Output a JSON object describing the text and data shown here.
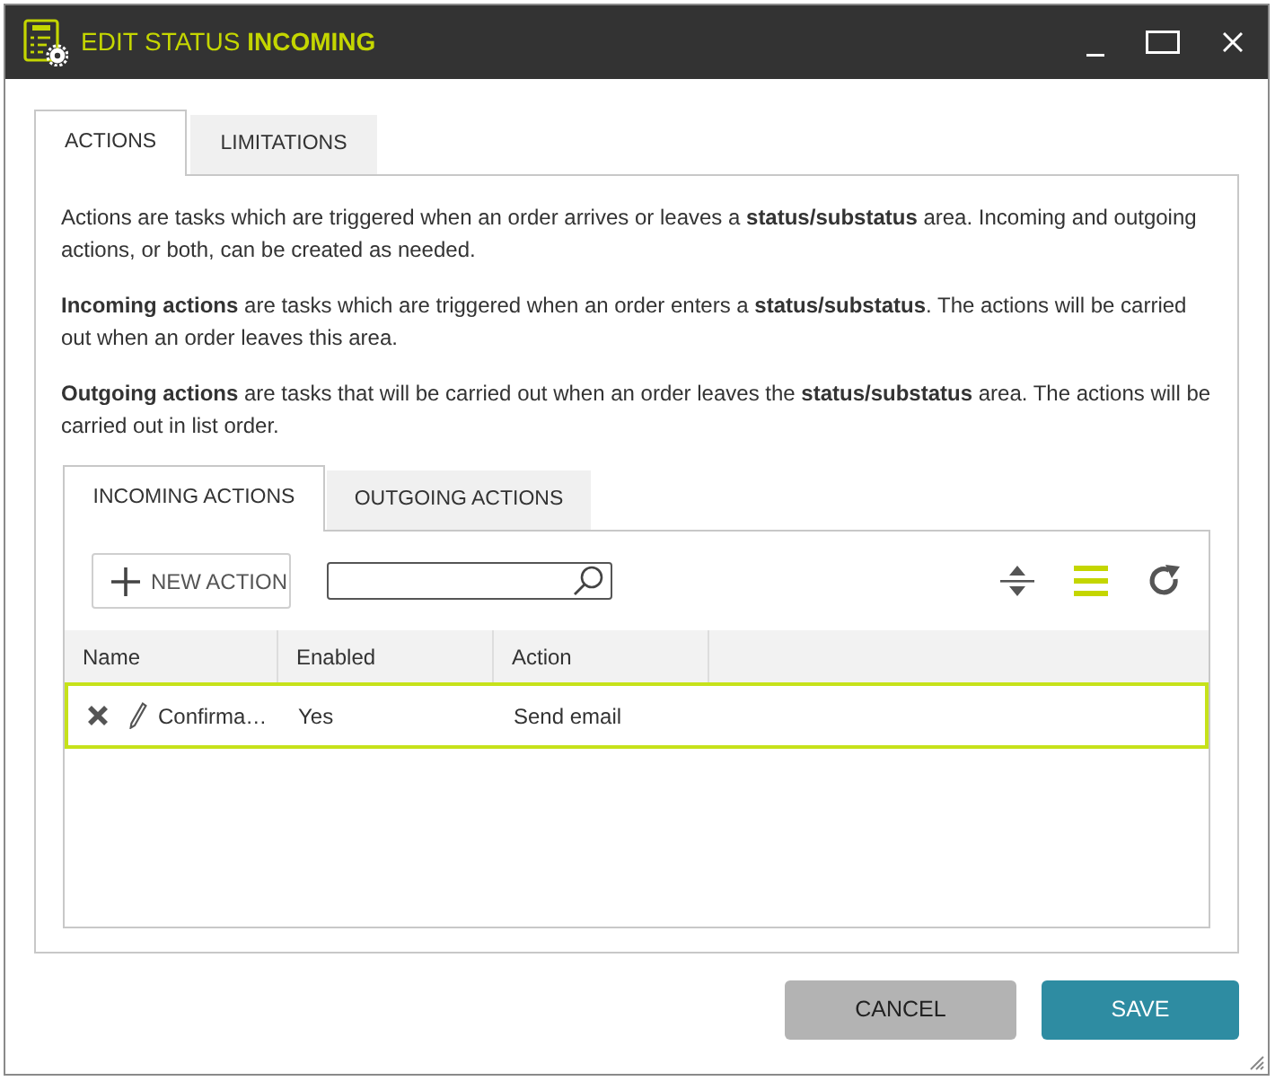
{
  "window": {
    "title": "EDIT STATUS **INCOMING**"
  },
  "tabs": [
    {
      "label": "ACTIONS",
      "selected": true
    },
    {
      "label": "LIMITATIONS",
      "selected": false
    }
  ],
  "description": [
    "Actions are tasks which are triggered when an order arrives or leaves a **status/substatus** area. Incoming and outgoing actions, or both, can be created as needed.",
    "**Incoming actions** are tasks which are triggered when an order enters a **status/substatus**. The actions will be carried out when an order leaves this area.",
    "**Outgoing actions** are tasks that will be carried out when an order leaves the **status/substatus** area. The actions will be carried out in list order."
  ],
  "action_tabs": [
    {
      "label": "INCOMING ACTIONS",
      "selected": true
    },
    {
      "label": "OUTGOING ACTIONS",
      "selected": false
    }
  ],
  "toolbar": {
    "new_action_label": "NEW ACTION",
    "list_view_selected": true
  },
  "table": {
    "columns": [
      "Name",
      "Enabled",
      "Action"
    ],
    "rows": [
      {
        "name": "Confirma…",
        "enabled": "Yes",
        "action": "Send email",
        "selected": true
      }
    ]
  },
  "buttons": [
    {
      "label": "CANCEL",
      "kind": "secondary"
    },
    {
      "label": "SAVE",
      "kind": "primary"
    }
  ]
}
